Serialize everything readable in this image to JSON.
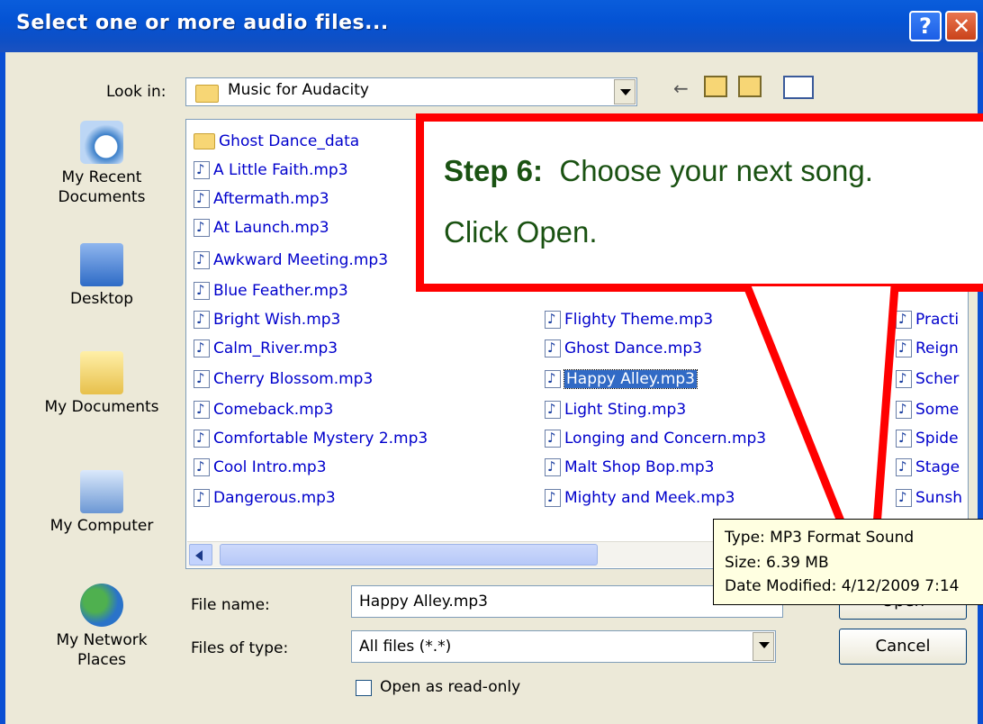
{
  "window": {
    "title": "Select one or more audio files...",
    "help_label": "?",
    "close_label": "✕"
  },
  "lookin": {
    "label": "Look in:",
    "value": "Music for Audacity"
  },
  "places": [
    {
      "label": "My Recent\nDocuments"
    },
    {
      "label": "Desktop"
    },
    {
      "label": "My Documents"
    },
    {
      "label": "My Computer"
    },
    {
      "label": "My Network\nPlaces"
    }
  ],
  "files_col1": [
    "Ghost Dance_data",
    "A Little Faith.mp3",
    "Aftermath.mp3",
    "At Launch.mp3",
    "Awkward Meeting.mp3",
    "Blue Feather.mp3",
    "Bright Wish.mp3",
    "Calm_River.mp3",
    "Cherry Blossom.mp3",
    "Comeback.mp3",
    "Comfortable Mystery 2.mp3",
    "Cool Intro.mp3",
    "Dangerous.mp3"
  ],
  "files_col2": [
    "Flighty Theme.mp3",
    "Ghost Dance.mp3",
    "Happy Alley.mp3",
    "Light Sting.mp3",
    "Longing and Concern.mp3",
    "Malt Shop Bop.mp3",
    "Mighty and Meek.mp3"
  ],
  "files_col3": [
    "Practi",
    "Reign",
    "Scher",
    "Some",
    "Spide",
    "Stage",
    "Sunsh"
  ],
  "filename": {
    "label": "File name:",
    "value": "Happy Alley.mp3"
  },
  "filetype": {
    "label": "Files of type:",
    "value": "All files (*.*)"
  },
  "readonly": {
    "label": "Open as read-only"
  },
  "buttons": {
    "open": "Open",
    "cancel": "Cancel"
  },
  "callout": {
    "step": "Step 6:",
    "text1": "Choose your next song.",
    "text2": "Click Open."
  },
  "tooltip": {
    "type": "Type: MP3 Format Sound",
    "size": "Size: 6.39 MB",
    "modified": "Date Modified: 4/12/2009 7:14"
  },
  "colors": {
    "accent": "#ff0000",
    "selection": "#316ac5",
    "title_bar": "#0453d4"
  }
}
